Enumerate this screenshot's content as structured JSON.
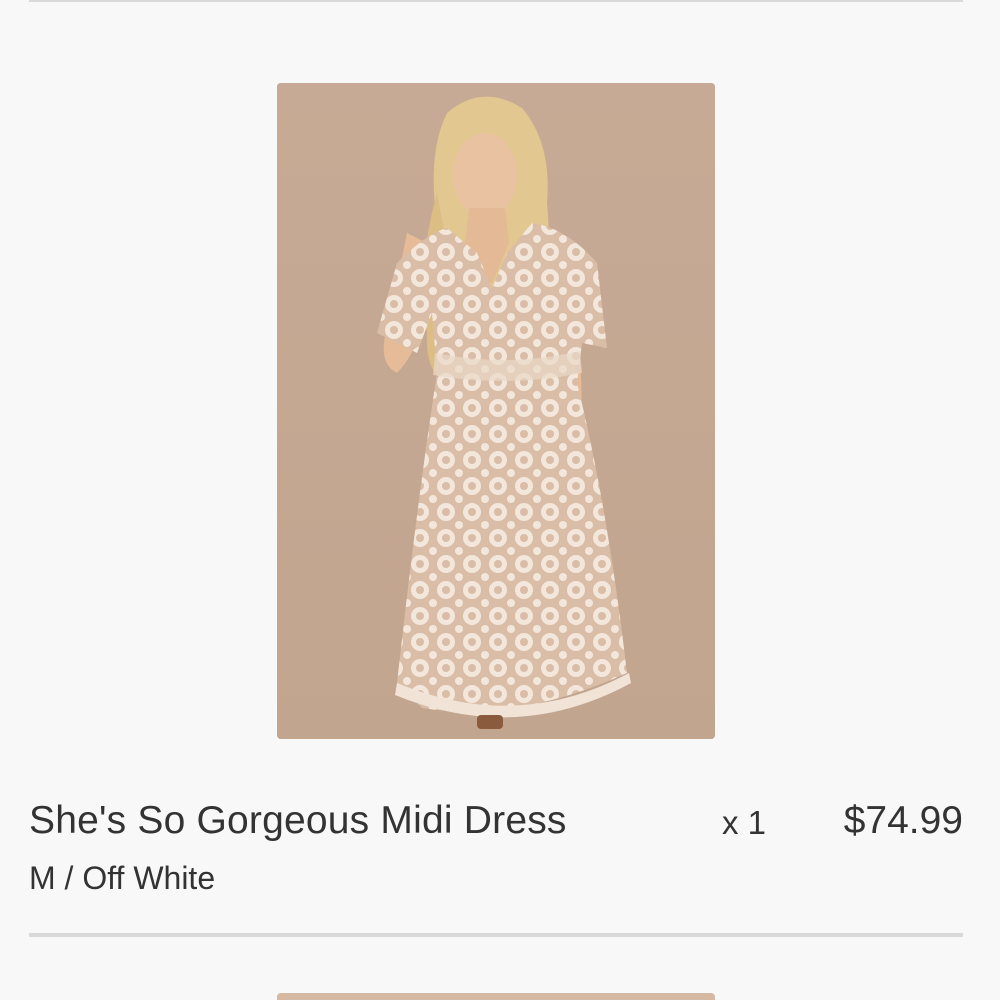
{
  "cart_item": {
    "name": "She's So Gorgeous Midi Dress",
    "variant": "M / Off White",
    "quantity": "x 1",
    "price": "$74.99",
    "image_alt": "woman wearing off white lace midi dress"
  },
  "colors": {
    "background": "#f8f8f8",
    "divider": "#d9d9d9",
    "text": "#333333",
    "photo_backdrop": "#c9ad97"
  }
}
